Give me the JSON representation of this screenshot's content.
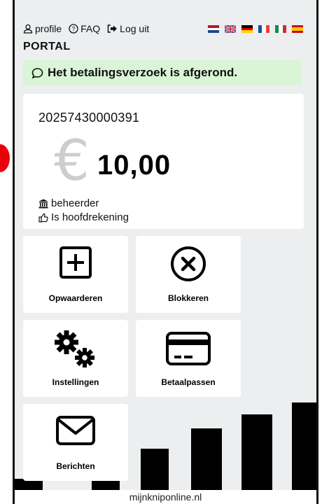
{
  "nav": {
    "profile_label": "profile",
    "faq_label": "FAQ",
    "logout_label": "Log uit",
    "portal_title": "PORTAL",
    "languages": [
      "nl",
      "en",
      "de",
      "fr",
      "it",
      "es"
    ]
  },
  "alert": {
    "message": "Het betalingsverzoek is afgerond.",
    "color": "#d9f5d6"
  },
  "account": {
    "number": "20257430000391",
    "currency_symbol": "€",
    "balance": "10,00",
    "role": "beheerder",
    "main_account_label": "Is hoofdrekening"
  },
  "tiles": [
    {
      "label": "Opwaarderen",
      "icon": "plus-square-icon"
    },
    {
      "label": "Blokkeren",
      "icon": "x-circle-icon"
    },
    {
      "label": "Instellingen",
      "icon": "gears-icon"
    },
    {
      "label": "Betaalpassen",
      "icon": "credit-card-icon"
    },
    {
      "label": "Berichten",
      "icon": "envelope-icon"
    }
  ],
  "footer": {
    "domain": "mijnkniponline.nl"
  }
}
